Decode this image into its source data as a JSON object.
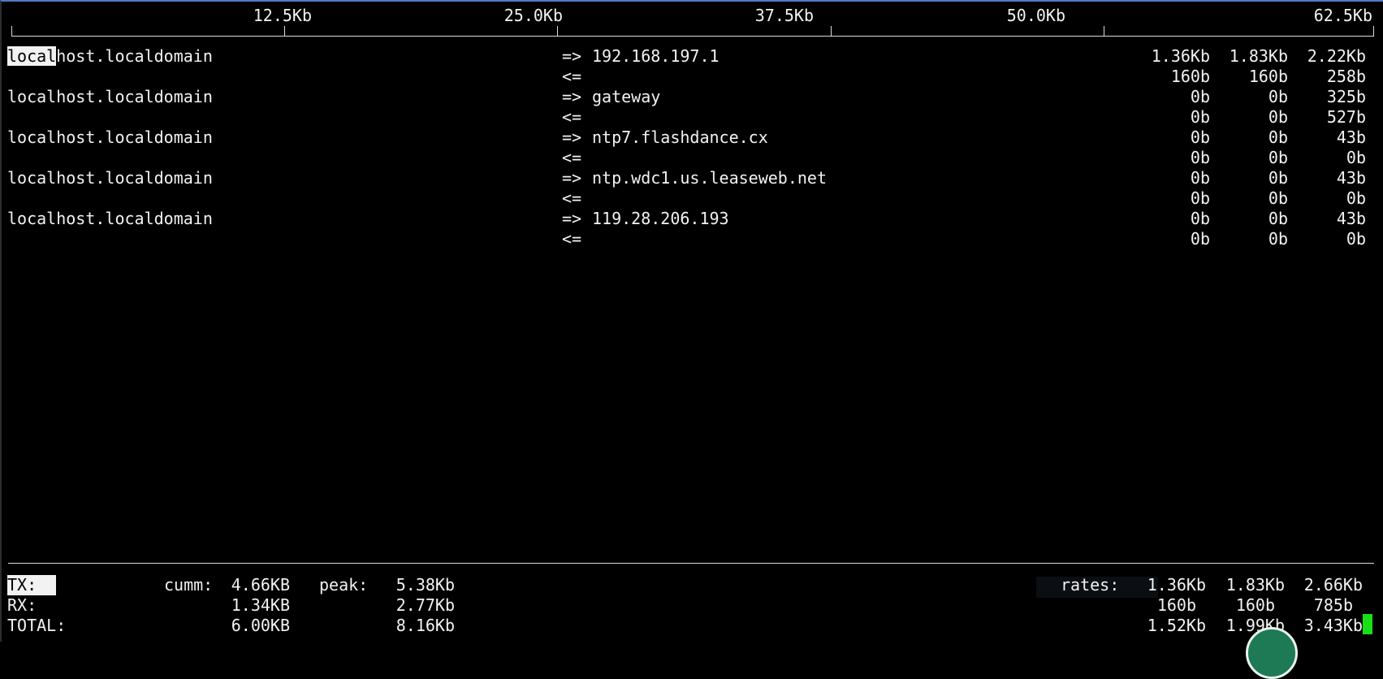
{
  "scale": {
    "labels": [
      "12.5Kb",
      "25.0Kb",
      "37.5Kb",
      "50.0Kb",
      "62.5Kb"
    ]
  },
  "cursor_text": "local",
  "connections": [
    {
      "source_rest": "host.localdomain",
      "out_arrow": "=>",
      "dest": "192.168.197.1",
      "in_arrow": "<=",
      "tx": [
        "1.36Kb",
        "1.83Kb",
        "2.22Kb"
      ],
      "rx": [
        "160b",
        "160b",
        "258b"
      ]
    },
    {
      "source": "localhost.localdomain",
      "out_arrow": "=>",
      "dest": "gateway",
      "in_arrow": "<=",
      "tx": [
        "0b",
        "0b",
        "325b"
      ],
      "rx": [
        "0b",
        "0b",
        "527b"
      ]
    },
    {
      "source": "localhost.localdomain",
      "out_arrow": "=>",
      "dest": "ntp7.flashdance.cx",
      "in_arrow": "<=",
      "tx": [
        "0b",
        "0b",
        "43b"
      ],
      "rx": [
        "0b",
        "0b",
        "0b"
      ]
    },
    {
      "source": "localhost.localdomain",
      "out_arrow": "=>",
      "dest": "ntp.wdc1.us.leaseweb.net",
      "in_arrow": "<=",
      "tx": [
        "0b",
        "0b",
        "43b"
      ],
      "rx": [
        "0b",
        "0b",
        "0b"
      ]
    },
    {
      "source": "localhost.localdomain",
      "out_arrow": "=>",
      "dest": "119.28.206.193",
      "in_arrow": "<=",
      "tx": [
        "0b",
        "0b",
        "43b"
      ],
      "rx": [
        "0b",
        "0b",
        "0b"
      ]
    }
  ],
  "totals": {
    "tx_label": "TX:",
    "rx_label": "RX:",
    "total_label": "TOTAL:",
    "cumm_label": "cumm:",
    "peak_label": "peak:",
    "rates_label": "rates:",
    "tx_cumm": "4.66KB",
    "tx_peak": "5.38Kb",
    "tx_rates": [
      "1.36Kb",
      "1.83Kb",
      "2.66Kb"
    ],
    "rx_cumm": "1.34KB",
    "rx_peak": "2.77Kb",
    "rx_rates": [
      "160b",
      "160b",
      "785b"
    ],
    "total_cumm": "6.00KB",
    "total_peak": "8.16Kb",
    "total_rates": [
      "1.52Kb",
      "1.99Kb",
      "3.43Kb"
    ]
  },
  "colors": {
    "background": "#000000",
    "foreground": "#f2f2f2",
    "cursor": "#17e017",
    "window_border": "#4f79c8"
  }
}
